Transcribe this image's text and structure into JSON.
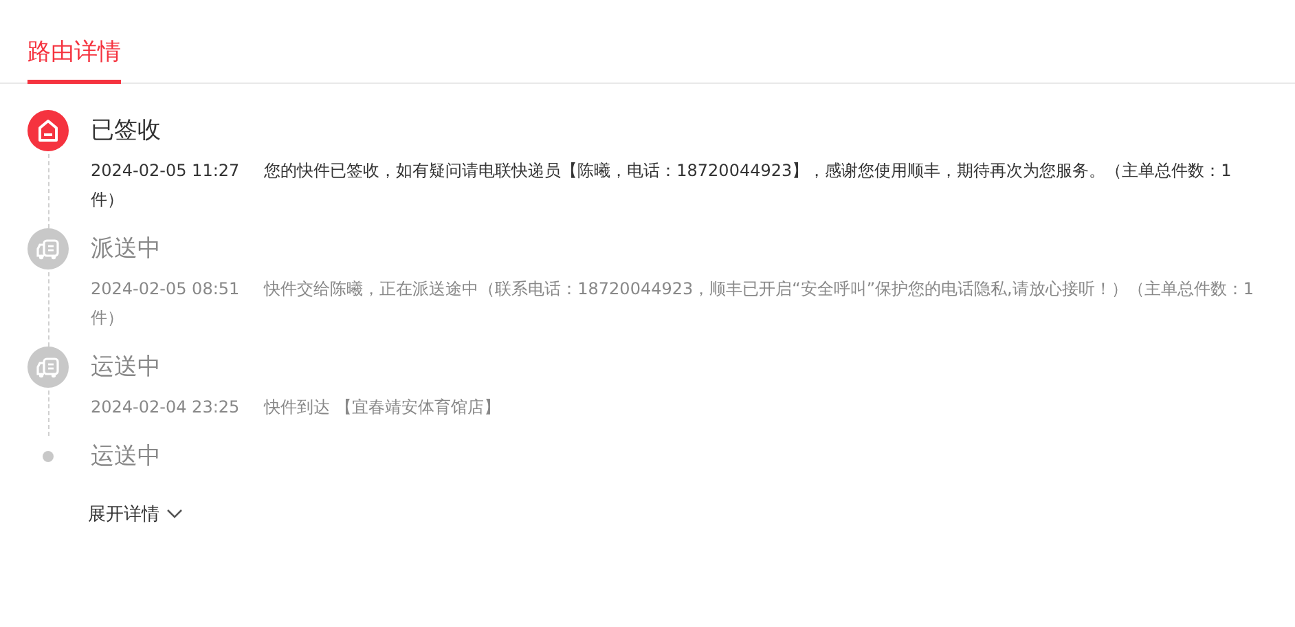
{
  "tab": {
    "label": "路由详情",
    "selected": true
  },
  "events": [
    {
      "status": "已签收",
      "kind": "house",
      "active": true,
      "time": "2024-02-05 11:27",
      "message": "您的快件已签收，如有疑问请电联快递员【陈曦，电话：18720044923】，感谢您使用顺丰，期待再次为您服务。（主单总件数：1件）"
    },
    {
      "status": "派送中",
      "kind": "truck",
      "active": false,
      "time": "2024-02-05 08:51",
      "message": "快件交给陈曦，正在派送途中（联系电话：18720044923，顺丰已开启“安全呼叫”保护您的电话隐私,请放心接听！）（主单总件数：1件）"
    },
    {
      "status": "运送中",
      "kind": "truck",
      "active": false,
      "time": "2024-02-04 23:25",
      "message": "快件到达 【宜春靖安体育馆店】"
    },
    {
      "status": "运送中",
      "kind": "dot",
      "active": false
    }
  ],
  "expand": {
    "label": "展开详情"
  }
}
